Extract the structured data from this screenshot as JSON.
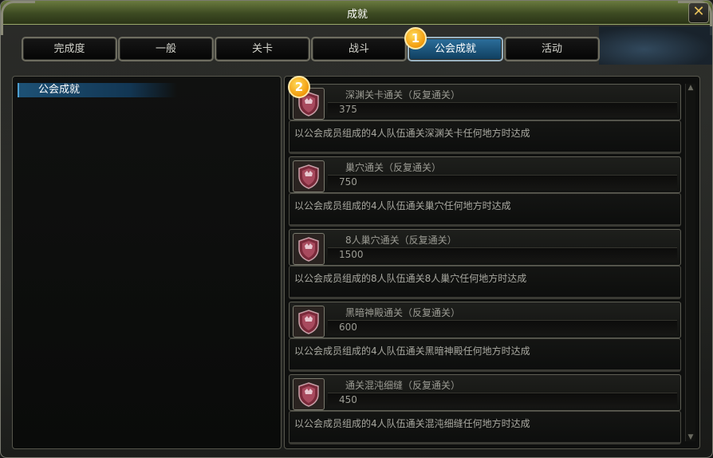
{
  "window": {
    "title": "成就",
    "close_label": "✕"
  },
  "tabs": [
    {
      "label": "完成度",
      "active": false
    },
    {
      "label": "一般",
      "active": false
    },
    {
      "label": "关卡",
      "active": false
    },
    {
      "label": "战斗",
      "active": false
    },
    {
      "label": "公会成就",
      "active": true
    },
    {
      "label": "活动",
      "active": false
    }
  ],
  "markers": {
    "first": "1",
    "second": "2"
  },
  "category_tree": {
    "selected": "公会成就"
  },
  "achievements": [
    {
      "name": "深渊关卡通关（反复通关）",
      "points": "375",
      "description": "以公会成员组成的4人队伍通关深渊关卡任何地方时达成",
      "icon": "guild-shield-icon"
    },
    {
      "name": "巢穴通关（反复通关）",
      "points": "750",
      "description": "以公会成员组成的4人队伍通关巢穴任何地方时达成",
      "icon": "guild-shield-icon"
    },
    {
      "name": "8人巢穴通关（反复通关）",
      "points": "1500",
      "description": "以公会成员组成的8人队伍通关8人巢穴任何地方时达成",
      "icon": "guild-shield-icon"
    },
    {
      "name": "黑暗神殿通关（反复通关）",
      "points": "600",
      "description": "以公会成员组成的4人队伍通关黑暗神殿任何地方时达成",
      "icon": "guild-shield-icon"
    },
    {
      "name": "通关混沌细缝（反复通关）",
      "points": "450",
      "description": "以公会成员组成的4人队伍通关混沌细缝任何地方时达成",
      "icon": "guild-shield-icon"
    }
  ],
  "colors": {
    "accent_tab": "#1f5a82",
    "title_bar": "#4b5a2a",
    "badge": "#f29a0b"
  }
}
